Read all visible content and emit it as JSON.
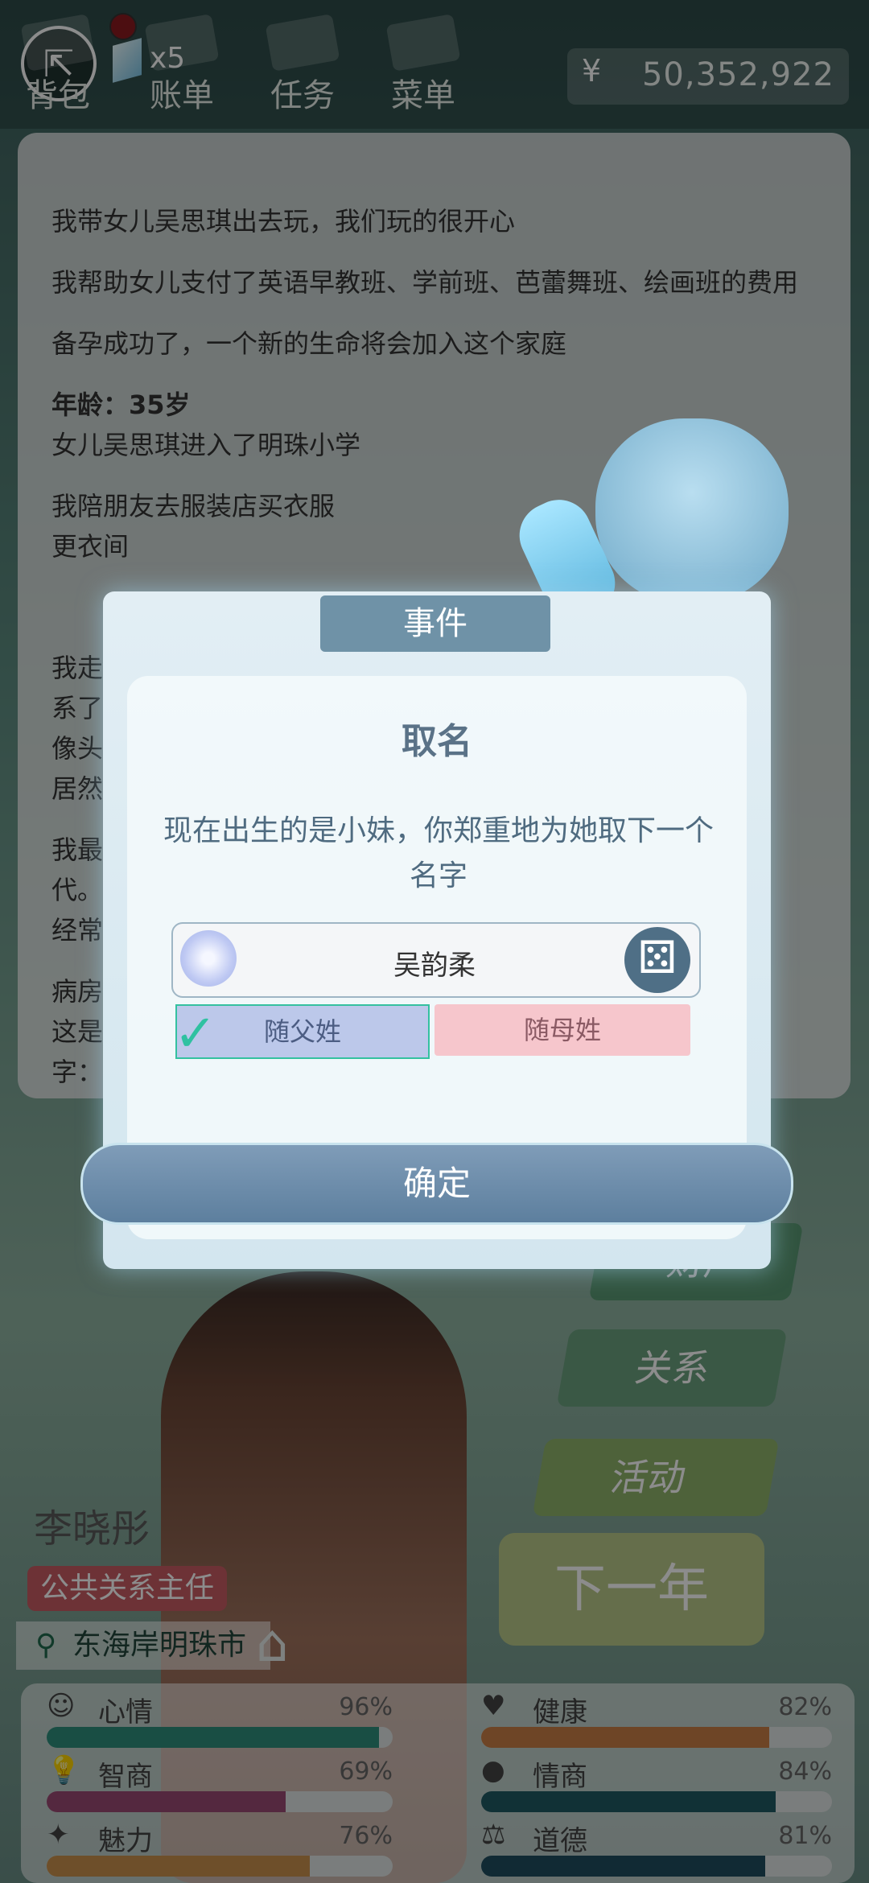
{
  "top": {
    "gem_count": "x5",
    "tools": [
      "背包",
      "账单",
      "任务",
      "菜单"
    ],
    "currency_symbol": "¥",
    "money": "50,352,922"
  },
  "log": {
    "lines": [
      "我带女儿吴思琪出去玩，我们玩的很开心",
      "我帮助女儿支付了英语早教班、学前班、芭蕾舞班、绘画班的费用",
      "备孕成功了，一个新的生命将会加入这个家庭",
      "年龄：35岁",
      "女儿吴思琪进入了明珠小学",
      "我陪朋友去服装店买衣服",
      "更衣间",
      "我走",
      "系了",
      "像头",
      "居然",
      "我最",
      "代。",
      "经常",
      "病房",
      "这是",
      "字："
    ]
  },
  "dialog": {
    "header": "事件",
    "title": "取名",
    "desc": "现在出生的是小妹，你郑重地为她取下一个名字",
    "name_value": "吴韵柔",
    "dice_glyph": "⚄",
    "option_father": "随父姓",
    "option_mother": "随母姓",
    "confirm": "确定"
  },
  "side": {
    "finance": "财产",
    "relations": "关系",
    "activities": "活动",
    "next_year": "下一年"
  },
  "player": {
    "name": "李晓彤",
    "job": "公共关系主任",
    "location": "东海岸明珠市"
  },
  "stats": [
    {
      "label": "心情",
      "pct": "96%",
      "value": 0.96,
      "color": "#2f8f7d"
    },
    {
      "label": "健康",
      "pct": "82%",
      "value": 0.82,
      "color": "#c97f46"
    },
    {
      "label": "智商",
      "pct": "69%",
      "value": 0.69,
      "color": "#9a4a73"
    },
    {
      "label": "情商",
      "pct": "84%",
      "value": 0.84,
      "color": "#1f5a63"
    },
    {
      "label": "魅力",
      "pct": "76%",
      "value": 0.76,
      "color": "#c9914e"
    },
    {
      "label": "道德",
      "pct": "81%",
      "value": 0.81,
      "color": "#1f4d5f"
    }
  ]
}
